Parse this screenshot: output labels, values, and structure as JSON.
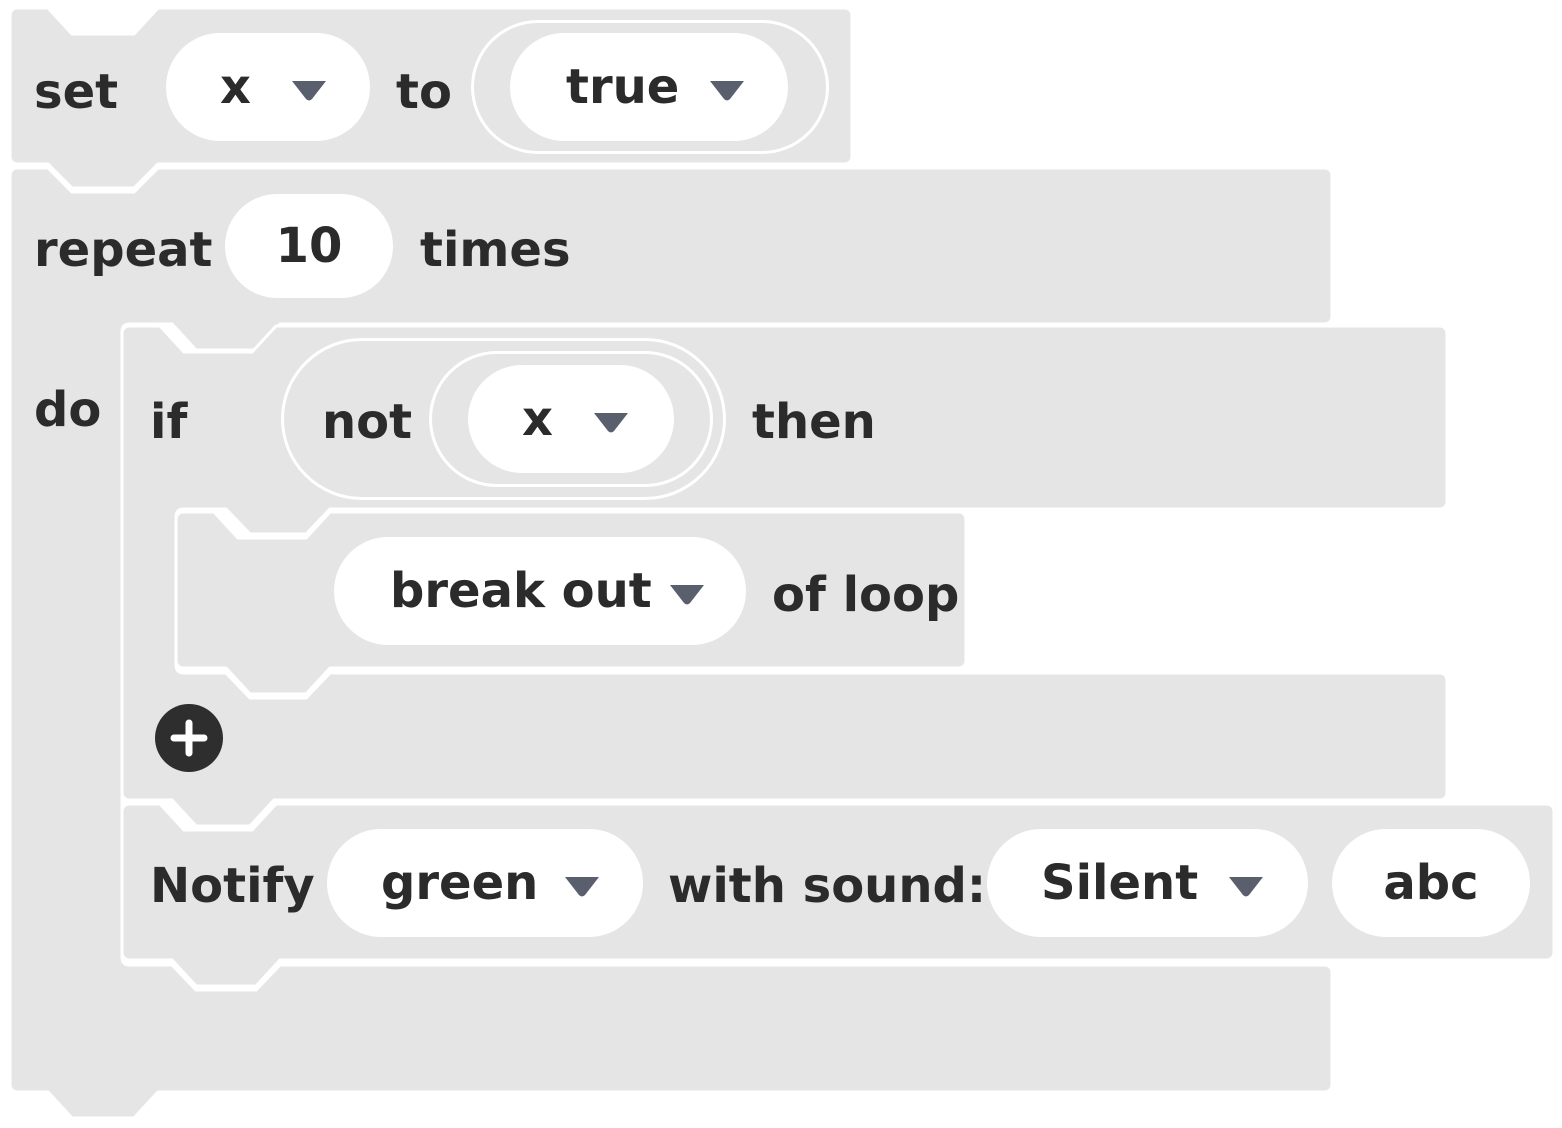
{
  "blocks": {
    "set_var": {
      "keyword": "set",
      "variable": "x",
      "connector": "to",
      "value": "true"
    },
    "repeat": {
      "keyword": "repeat",
      "count": "10",
      "suffix": "times",
      "do_label": "do"
    },
    "if_block": {
      "keyword": "if",
      "not_keyword": "not",
      "variable": "x",
      "then_label": "then"
    },
    "break_block": {
      "option": "break out",
      "suffix": "of loop"
    },
    "notify": {
      "keyword": "Notify",
      "color_option": "green",
      "sound_label": "with sound:",
      "sound_option": "Silent",
      "message": "abc"
    }
  },
  "colors": {
    "block_fill": "#e5e5e5",
    "block_outline": "#ffffff",
    "caret": "#5a5f6e",
    "text": "#2b2b2b",
    "add_button": "#2e2e2e"
  },
  "icons": {
    "dropdown": "chevron-down-icon",
    "add": "plus-icon"
  }
}
